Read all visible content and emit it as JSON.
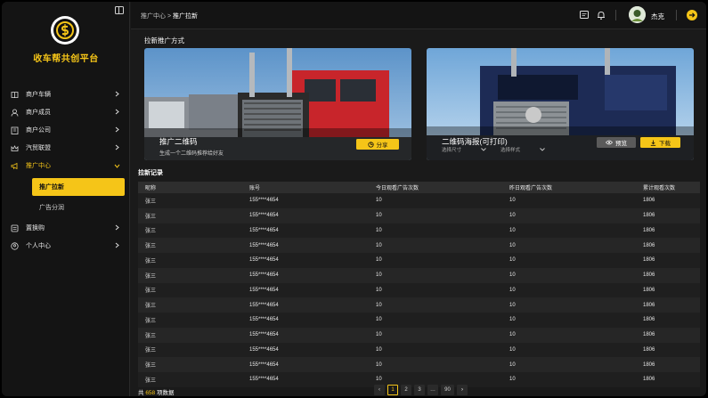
{
  "sidebar": {
    "brand": "收车帮共创平台",
    "items": [
      {
        "label": "商户车辆",
        "icon": "book-icon"
      },
      {
        "label": "商户成员",
        "icon": "user-icon"
      },
      {
        "label": "商户公司",
        "icon": "building-icon"
      },
      {
        "label": "汽贸联盟",
        "icon": "crown-icon"
      },
      {
        "label": "推广中心",
        "icon": "megaphone-icon"
      },
      {
        "label": "置换购",
        "icon": "list-icon"
      },
      {
        "label": "个人中心",
        "icon": "person-circle-icon"
      }
    ],
    "sub_items": [
      {
        "label": "推广拉新"
      },
      {
        "label": "广告分润"
      }
    ]
  },
  "header": {
    "breadcrumb_parent": "推广中心",
    "breadcrumb_sep": ">",
    "breadcrumb_current": "推广拉新",
    "username": "杰克"
  },
  "main": {
    "section_title": "拉新推广方式",
    "card1": {
      "title": "推广二维码",
      "subtitle": "生成一个二维码推荐给好友",
      "share_label": "分享"
    },
    "card2": {
      "title": "二维码海报(可打印)",
      "select_size": "选择尺寸",
      "select_style": "选择样式",
      "preview_label": "预览",
      "download_label": "下载"
    },
    "records_title": "拉新记录",
    "table": {
      "headers": [
        "昵称",
        "账号",
        "今日观看广告次数",
        "昨日观看广告次数",
        "累计观看次数"
      ],
      "rows": [
        [
          "张三",
          "155****4654",
          "10",
          "10",
          "1806"
        ],
        [
          "张三",
          "155****4654",
          "10",
          "10",
          "1806"
        ],
        [
          "张三",
          "155****4654",
          "10",
          "10",
          "1806"
        ],
        [
          "张三",
          "155****4654",
          "10",
          "10",
          "1806"
        ],
        [
          "张三",
          "155****4654",
          "10",
          "10",
          "1806"
        ],
        [
          "张三",
          "155****4654",
          "10",
          "10",
          "1806"
        ],
        [
          "张三",
          "155****4654",
          "10",
          "10",
          "1806"
        ],
        [
          "张三",
          "155****4654",
          "10",
          "10",
          "1806"
        ],
        [
          "张三",
          "155****4654",
          "10",
          "10",
          "1806"
        ],
        [
          "张三",
          "155****4654",
          "10",
          "10",
          "1806"
        ],
        [
          "张三",
          "155****4654",
          "10",
          "10",
          "1806"
        ],
        [
          "张三",
          "155****4654",
          "10",
          "10",
          "1806"
        ],
        [
          "张三",
          "155****4654",
          "10",
          "10",
          "1806"
        ]
      ]
    },
    "total_prefix": "共",
    "total_count": "658",
    "total_suffix": "项数据",
    "pagination": {
      "prev": "‹",
      "pages": [
        "1",
        "2",
        "3",
        "…",
        "90"
      ],
      "next": "›",
      "current": "1"
    }
  },
  "colors": {
    "accent": "#f5c518",
    "background": "#1a1a1a",
    "sidebar": "#141414"
  }
}
